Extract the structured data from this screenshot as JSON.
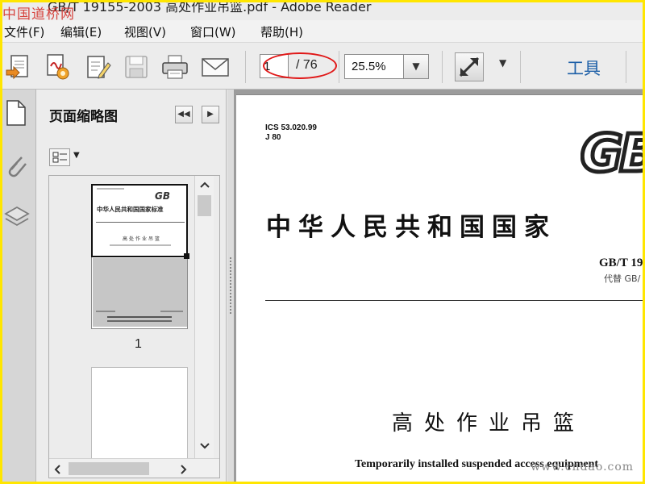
{
  "window": {
    "title": "GB/T 19155-2003 高处作业吊篮.pdf - Adobe Reader",
    "watermark_top": "中国道桥网",
    "watermark_bottom": "www.cndao.com"
  },
  "menu": {
    "items": [
      {
        "label": "文件(F)"
      },
      {
        "label": "编辑(E)"
      },
      {
        "label": "视图(V)"
      },
      {
        "label": "窗口(W)"
      },
      {
        "label": "帮助(H)"
      }
    ]
  },
  "toolbar": {
    "page_current": "1",
    "page_total": "/ 76",
    "zoom": "25.5%",
    "tools_label": "工具",
    "icons": [
      "open-icon",
      "create-pdf-icon",
      "edit-icon",
      "save-icon",
      "print-icon",
      "email-icon",
      "fullscreen-icon",
      "chevron-down-icon"
    ],
    "annotation_color": "#e01818"
  },
  "panel": {
    "title": "页面缩略图",
    "thumbnails": [
      {
        "number": "1",
        "gb": "GB",
        "line1": "中华人民共和国国家标准",
        "line2": "高处作业吊篮"
      },
      {
        "number": "",
        "gb": "",
        "line1": "",
        "line2": ""
      }
    ]
  },
  "document": {
    "ics": "ICS 53.020.99",
    "class_code": "J 80",
    "gb_logo": "GB",
    "heading": "中华人民共和国国家",
    "std_number": "GB/T 19",
    "replaces": "代替 GB/",
    "cn_title": "高处作业吊篮",
    "en_title": "Temporarily installed suspended access equipment"
  },
  "colors": {
    "border": "#ffe600",
    "tools": "#1d5fa7",
    "watermark_red": "#d4322c"
  }
}
